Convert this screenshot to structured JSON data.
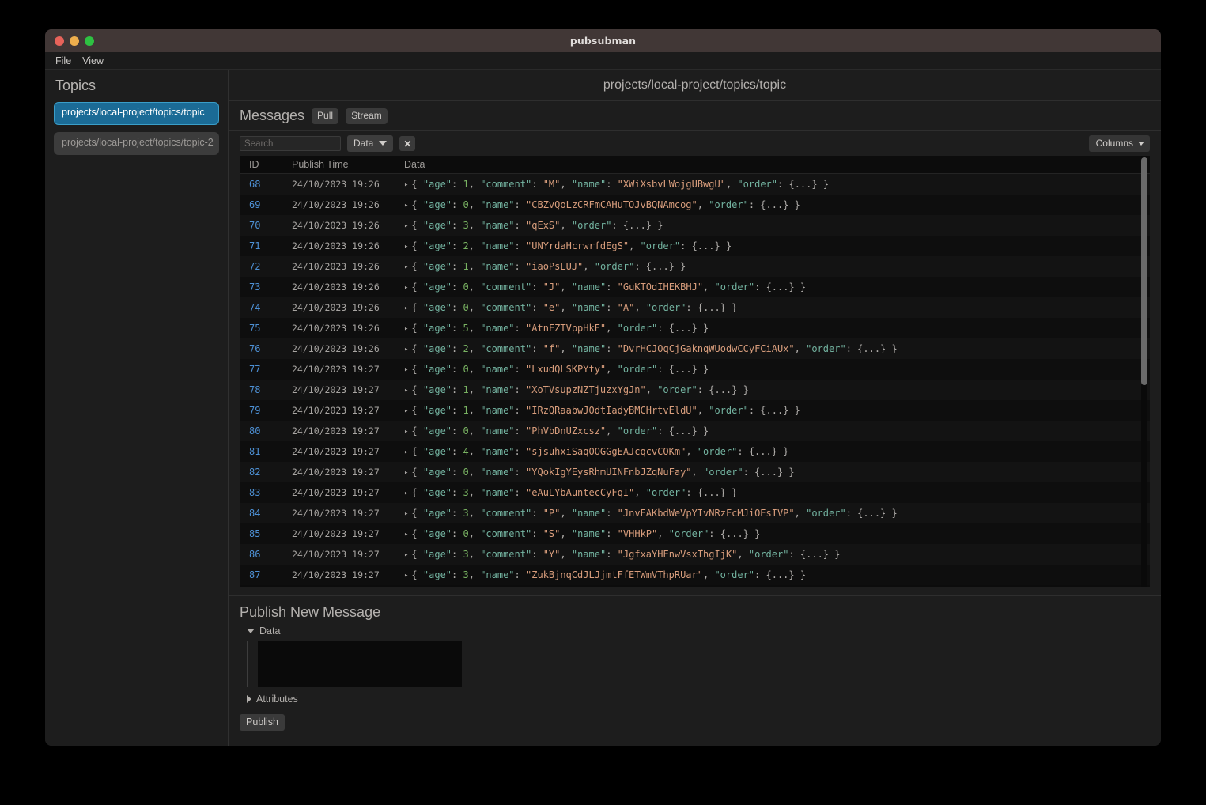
{
  "window": {
    "title": "pubsubman",
    "traffic_lights": [
      "close-button",
      "minimize-button",
      "maximize-button"
    ]
  },
  "menubar": {
    "items": [
      {
        "label": "File"
      },
      {
        "label": "View"
      }
    ]
  },
  "sidebar": {
    "title": "Topics",
    "items": [
      {
        "label": "projects/local-project/topics/topic",
        "selected": true
      },
      {
        "label": "projects/local-project/topics/topic-2",
        "selected": false
      }
    ]
  },
  "main": {
    "header_title": "projects/local-project/topics/topic",
    "messages_label": "Messages",
    "pull_label": "Pull",
    "stream_label": "Stream"
  },
  "filters": {
    "search_value": "",
    "search_placeholder": "Search",
    "field_dropdown_label": "Data",
    "clear_label": "✕",
    "columns_label": "Columns"
  },
  "table": {
    "columns": [
      "ID",
      "Publish Time",
      "Data"
    ],
    "rows": [
      {
        "id": "68",
        "time": "24/10/2023 19:26",
        "age": "1",
        "comment": "M",
        "name": "XWiXsbvLWojgUBwgU"
      },
      {
        "id": "69",
        "time": "24/10/2023 19:26",
        "age": "0",
        "comment": null,
        "name": "CBZvQoLzCRFmCAHuTOJvBQNAmcog"
      },
      {
        "id": "70",
        "time": "24/10/2023 19:26",
        "age": "3",
        "comment": null,
        "name": "qExS"
      },
      {
        "id": "71",
        "time": "24/10/2023 19:26",
        "age": "2",
        "comment": null,
        "name": "UNYrdaHcrwrfdEgS"
      },
      {
        "id": "72",
        "time": "24/10/2023 19:26",
        "age": "1",
        "comment": null,
        "name": "iaoPsLUJ"
      },
      {
        "id": "73",
        "time": "24/10/2023 19:26",
        "age": "0",
        "comment": "J",
        "name": "GuKTOdIHEKBHJ"
      },
      {
        "id": "74",
        "time": "24/10/2023 19:26",
        "age": "0",
        "comment": "e",
        "name": "A"
      },
      {
        "id": "75",
        "time": "24/10/2023 19:26",
        "age": "5",
        "comment": null,
        "name": "AtnFZTVppHkE"
      },
      {
        "id": "76",
        "time": "24/10/2023 19:26",
        "age": "2",
        "comment": "f",
        "name": "DvrHCJOqCjGaknqWUodwCCyFCiAUx"
      },
      {
        "id": "77",
        "time": "24/10/2023 19:27",
        "age": "0",
        "comment": null,
        "name": "LxudQLSKPYty"
      },
      {
        "id": "78",
        "time": "24/10/2023 19:27",
        "age": "1",
        "comment": null,
        "name": "XoTVsupzNZTjuzxYgJn"
      },
      {
        "id": "79",
        "time": "24/10/2023 19:27",
        "age": "1",
        "comment": null,
        "name": "IRzQRaabwJOdtIadyBMCHrtvEldU"
      },
      {
        "id": "80",
        "time": "24/10/2023 19:27",
        "age": "0",
        "comment": null,
        "name": "PhVbDnUZxcsz"
      },
      {
        "id": "81",
        "time": "24/10/2023 19:27",
        "age": "4",
        "comment": null,
        "name": "sjsuhxiSaqOOGGgEAJcqcvCQKm"
      },
      {
        "id": "82",
        "time": "24/10/2023 19:27",
        "age": "0",
        "comment": null,
        "name": "YQokIgYEysRhmUINFnbJZqNuFay"
      },
      {
        "id": "83",
        "time": "24/10/2023 19:27",
        "age": "3",
        "comment": null,
        "name": "eAuLYbAuntecCyFqI"
      },
      {
        "id": "84",
        "time": "24/10/2023 19:27",
        "age": "3",
        "comment": "P",
        "name": "JnvEAKbdWeVpYIvNRzFcMJiOEsIVP"
      },
      {
        "id": "85",
        "time": "24/10/2023 19:27",
        "age": "0",
        "comment": "S",
        "name": "VHHkP"
      },
      {
        "id": "86",
        "time": "24/10/2023 19:27",
        "age": "3",
        "comment": "Y",
        "name": "JgfxaYHEnwVsxThgIjK"
      },
      {
        "id": "87",
        "time": "24/10/2023 19:27",
        "age": "3",
        "comment": null,
        "name": "ZukBjnqCdJLJjmtFfETWmVThpRUar"
      }
    ],
    "order_placeholder": "{...}",
    "expander_glyph": "▸"
  },
  "publish": {
    "title": "Publish New Message",
    "data_label": "Data",
    "data_value": "",
    "attributes_label": "Attributes",
    "publish_button": "Publish"
  },
  "colors": {
    "accent": "#1b6b96",
    "json_key": "#73b3a0",
    "json_string": "#d89d7c",
    "json_number": "#79b362",
    "id_link": "#4d90d4",
    "titlebar": "#413736"
  }
}
